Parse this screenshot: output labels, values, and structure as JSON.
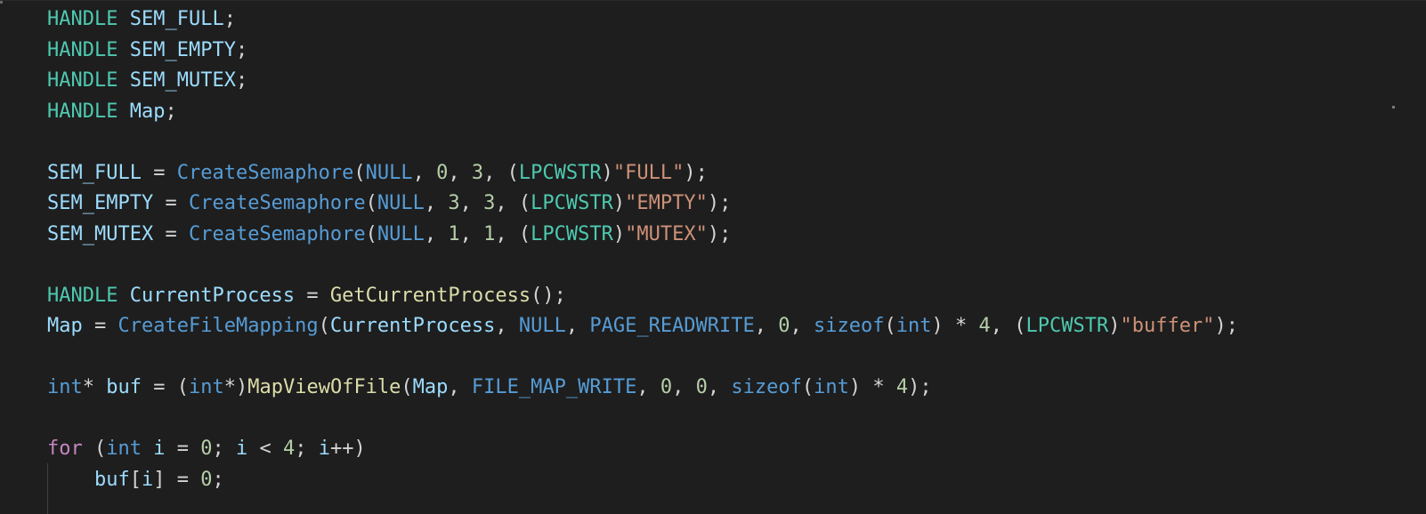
{
  "editor": {
    "lines": [
      [
        {
          "t": "HANDLE",
          "c": "kw-type"
        },
        {
          "t": " ",
          "c": "plain"
        },
        {
          "t": "SEM_FULL",
          "c": "var"
        },
        {
          "t": ";",
          "c": "plain"
        }
      ],
      [
        {
          "t": "HANDLE",
          "c": "kw-type"
        },
        {
          "t": " ",
          "c": "plain"
        },
        {
          "t": "SEM_EMPTY",
          "c": "var"
        },
        {
          "t": ";",
          "c": "plain"
        }
      ],
      [
        {
          "t": "HANDLE",
          "c": "kw-type"
        },
        {
          "t": " ",
          "c": "plain"
        },
        {
          "t": "SEM_MUTEX",
          "c": "var"
        },
        {
          "t": ";",
          "c": "plain"
        }
      ],
      [
        {
          "t": "HANDLE",
          "c": "kw-type"
        },
        {
          "t": " ",
          "c": "plain"
        },
        {
          "t": "Map",
          "c": "var"
        },
        {
          "t": ";",
          "c": "plain"
        }
      ],
      [],
      [
        {
          "t": "SEM_FULL",
          "c": "var"
        },
        {
          "t": " = ",
          "c": "plain"
        },
        {
          "t": "CreateSemaphore",
          "c": "fn-mac"
        },
        {
          "t": "(",
          "c": "plain"
        },
        {
          "t": "NULL",
          "c": "macro"
        },
        {
          "t": ", ",
          "c": "plain"
        },
        {
          "t": "0",
          "c": "num"
        },
        {
          "t": ", ",
          "c": "plain"
        },
        {
          "t": "3",
          "c": "num"
        },
        {
          "t": ", (",
          "c": "plain"
        },
        {
          "t": "LPCWSTR",
          "c": "kw-type"
        },
        {
          "t": ")",
          "c": "plain"
        },
        {
          "t": "\"FULL\"",
          "c": "str"
        },
        {
          "t": ");",
          "c": "plain"
        }
      ],
      [
        {
          "t": "SEM_EMPTY",
          "c": "var"
        },
        {
          "t": " = ",
          "c": "plain"
        },
        {
          "t": "CreateSemaphore",
          "c": "fn-mac"
        },
        {
          "t": "(",
          "c": "plain"
        },
        {
          "t": "NULL",
          "c": "macro"
        },
        {
          "t": ", ",
          "c": "plain"
        },
        {
          "t": "3",
          "c": "num"
        },
        {
          "t": ", ",
          "c": "plain"
        },
        {
          "t": "3",
          "c": "num"
        },
        {
          "t": ", (",
          "c": "plain"
        },
        {
          "t": "LPCWSTR",
          "c": "kw-type"
        },
        {
          "t": ")",
          "c": "plain"
        },
        {
          "t": "\"EMPTY\"",
          "c": "str"
        },
        {
          "t": ");",
          "c": "plain"
        }
      ],
      [
        {
          "t": "SEM_MUTEX",
          "c": "var"
        },
        {
          "t": " = ",
          "c": "plain"
        },
        {
          "t": "CreateSemaphore",
          "c": "fn-mac"
        },
        {
          "t": "(",
          "c": "plain"
        },
        {
          "t": "NULL",
          "c": "macro"
        },
        {
          "t": ", ",
          "c": "plain"
        },
        {
          "t": "1",
          "c": "num"
        },
        {
          "t": ", ",
          "c": "plain"
        },
        {
          "t": "1",
          "c": "num"
        },
        {
          "t": ", (",
          "c": "plain"
        },
        {
          "t": "LPCWSTR",
          "c": "kw-type"
        },
        {
          "t": ")",
          "c": "plain"
        },
        {
          "t": "\"MUTEX\"",
          "c": "str"
        },
        {
          "t": ");",
          "c": "plain"
        }
      ],
      [],
      [
        {
          "t": "HANDLE",
          "c": "kw-type"
        },
        {
          "t": " ",
          "c": "plain"
        },
        {
          "t": "CurrentProcess",
          "c": "var"
        },
        {
          "t": " = ",
          "c": "plain"
        },
        {
          "t": "GetCurrentProcess",
          "c": "fn"
        },
        {
          "t": "();",
          "c": "plain"
        }
      ],
      [
        {
          "t": "Map",
          "c": "var"
        },
        {
          "t": " = ",
          "c": "plain"
        },
        {
          "t": "CreateFileMapping",
          "c": "fn-mac"
        },
        {
          "t": "(",
          "c": "plain"
        },
        {
          "t": "CurrentProcess",
          "c": "var"
        },
        {
          "t": ", ",
          "c": "plain"
        },
        {
          "t": "NULL",
          "c": "macro"
        },
        {
          "t": ", ",
          "c": "plain"
        },
        {
          "t": "PAGE_READWRITE",
          "c": "macro"
        },
        {
          "t": ", ",
          "c": "plain"
        },
        {
          "t": "0",
          "c": "num"
        },
        {
          "t": ", ",
          "c": "plain"
        },
        {
          "t": "sizeof",
          "c": "prim"
        },
        {
          "t": "(",
          "c": "plain"
        },
        {
          "t": "int",
          "c": "prim"
        },
        {
          "t": ") * ",
          "c": "plain"
        },
        {
          "t": "4",
          "c": "num"
        },
        {
          "t": ", (",
          "c": "plain"
        },
        {
          "t": "LPCWSTR",
          "c": "kw-type"
        },
        {
          "t": ")",
          "c": "plain"
        },
        {
          "t": "\"buffer\"",
          "c": "str"
        },
        {
          "t": ");",
          "c": "plain"
        }
      ],
      [],
      [
        {
          "t": "int",
          "c": "prim"
        },
        {
          "t": "* ",
          "c": "plain"
        },
        {
          "t": "buf",
          "c": "var"
        },
        {
          "t": " = (",
          "c": "plain"
        },
        {
          "t": "int",
          "c": "prim"
        },
        {
          "t": "*)",
          "c": "plain"
        },
        {
          "t": "MapViewOfFile",
          "c": "fn"
        },
        {
          "t": "(",
          "c": "plain"
        },
        {
          "t": "Map",
          "c": "var"
        },
        {
          "t": ", ",
          "c": "plain"
        },
        {
          "t": "FILE_MAP_WRITE",
          "c": "macro"
        },
        {
          "t": ", ",
          "c": "plain"
        },
        {
          "t": "0",
          "c": "num"
        },
        {
          "t": ", ",
          "c": "plain"
        },
        {
          "t": "0",
          "c": "num"
        },
        {
          "t": ", ",
          "c": "plain"
        },
        {
          "t": "sizeof",
          "c": "prim"
        },
        {
          "t": "(",
          "c": "plain"
        },
        {
          "t": "int",
          "c": "prim"
        },
        {
          "t": ") * ",
          "c": "plain"
        },
        {
          "t": "4",
          "c": "num"
        },
        {
          "t": ");",
          "c": "plain"
        }
      ],
      [],
      [
        {
          "t": "for",
          "c": "ctrl"
        },
        {
          "t": " (",
          "c": "plain"
        },
        {
          "t": "int",
          "c": "prim"
        },
        {
          "t": " ",
          "c": "plain"
        },
        {
          "t": "i",
          "c": "var"
        },
        {
          "t": " = ",
          "c": "plain"
        },
        {
          "t": "0",
          "c": "num"
        },
        {
          "t": "; ",
          "c": "plain"
        },
        {
          "t": "i",
          "c": "var"
        },
        {
          "t": " < ",
          "c": "plain"
        },
        {
          "t": "4",
          "c": "num"
        },
        {
          "t": "; ",
          "c": "plain"
        },
        {
          "t": "i",
          "c": "var"
        },
        {
          "t": "++)",
          "c": "plain"
        }
      ],
      [
        {
          "t": "    ",
          "c": "plain"
        },
        {
          "t": "buf",
          "c": "var"
        },
        {
          "t": "[",
          "c": "plain"
        },
        {
          "t": "i",
          "c": "var"
        },
        {
          "t": "] = ",
          "c": "plain"
        },
        {
          "t": "0",
          "c": "num"
        },
        {
          "t": ";",
          "c": "plain"
        }
      ]
    ]
  }
}
